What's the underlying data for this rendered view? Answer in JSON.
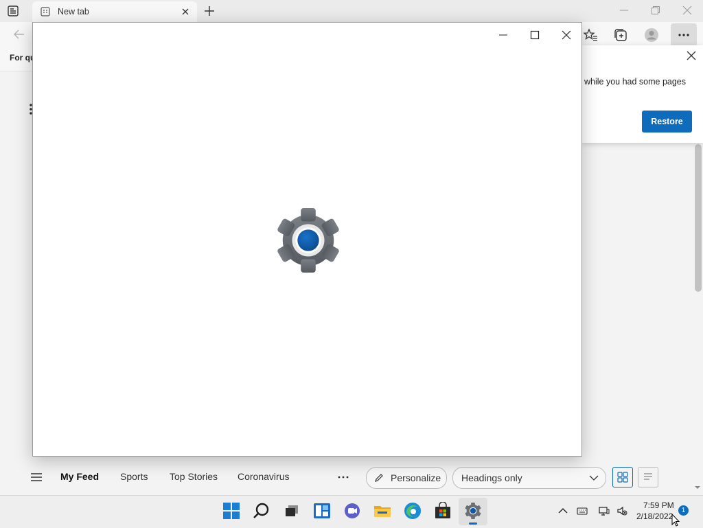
{
  "browser": {
    "tab_title": "New tab",
    "favorites_bar_text": "For qu",
    "toolbar_icons": [
      "favorites-star-icon",
      "collections-icon",
      "profile-avatar-icon",
      "more-options-icon"
    ]
  },
  "restore_popup": {
    "message": "while you had some pages",
    "restore_label": "Restore"
  },
  "feed": {
    "tabs": [
      "My Feed",
      "Sports",
      "Top Stories",
      "Coronavirus"
    ],
    "active_tab": "My Feed",
    "personalize_label": "Personalize",
    "layout_select_value": "Headings only"
  },
  "settings_window": {
    "app_icon": "settings-gear-icon"
  },
  "taskbar": {
    "apps": [
      "start-icon",
      "search-icon",
      "task-view-icon",
      "widgets-icon",
      "chat-icon",
      "file-explorer-icon",
      "edge-icon",
      "store-icon",
      "settings-icon"
    ],
    "active_app": "settings-icon",
    "time": "7:59 PM",
    "date": "2/18/2022",
    "notification_count": "1"
  },
  "colors": {
    "accent": "#0f6cbd",
    "gear_gray": "#6e7277",
    "gear_center": "#0f5aa8"
  }
}
